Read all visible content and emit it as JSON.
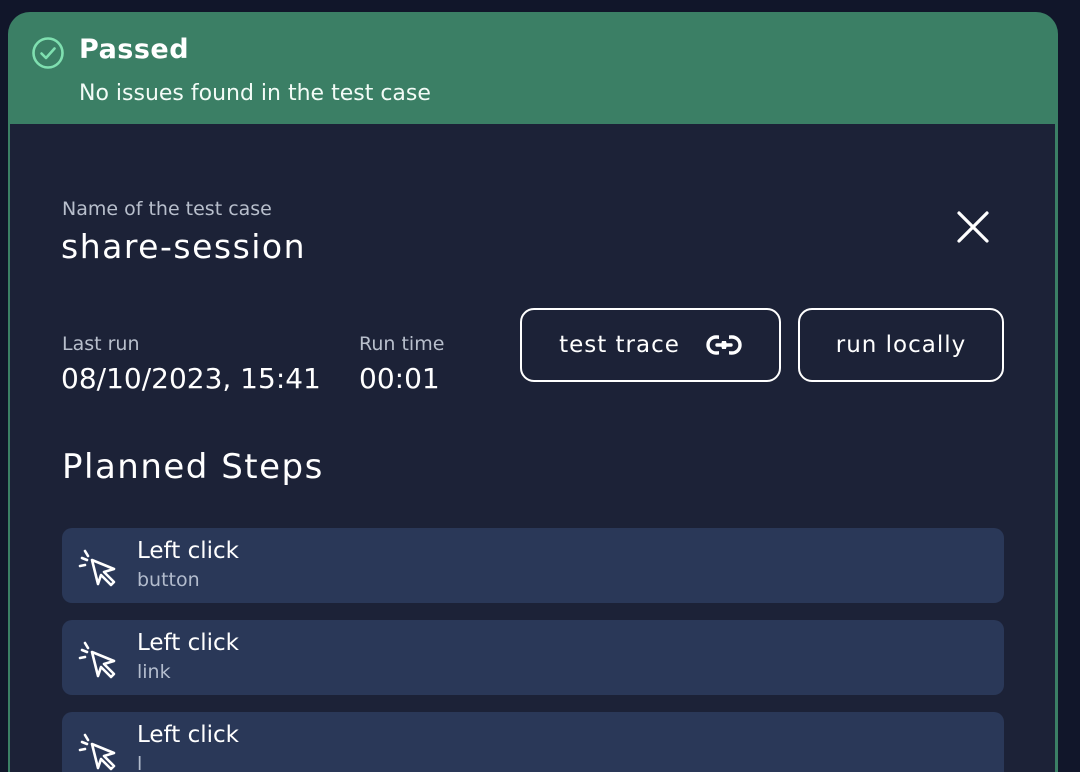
{
  "status": {
    "title": "Passed",
    "description": "No issues found in the test case"
  },
  "test_case": {
    "name_label": "Name of the test case",
    "name": "share-session"
  },
  "run_info": {
    "last_run_label": "Last run",
    "last_run": "08/10/2023, 15:41",
    "run_time_label": "Run time",
    "run_time": "00:01"
  },
  "actions": {
    "test_trace_label": "test trace",
    "run_locally_label": "run locally"
  },
  "planned_steps": {
    "title": "Planned Steps",
    "steps": [
      {
        "action": "Left click",
        "target": "button"
      },
      {
        "action": "Left click",
        "target": "link"
      },
      {
        "action": "Left click",
        "target": "l"
      }
    ]
  },
  "icons": {
    "status": "check-circle-icon",
    "close": "close-icon",
    "link": "link-icon",
    "step": "cursor-click-icon"
  },
  "colors": {
    "status_passed": "#3b7f65",
    "panel_background": "#1c2237",
    "step_background": "#2a3858",
    "check_icon": "#7fe0b0"
  }
}
